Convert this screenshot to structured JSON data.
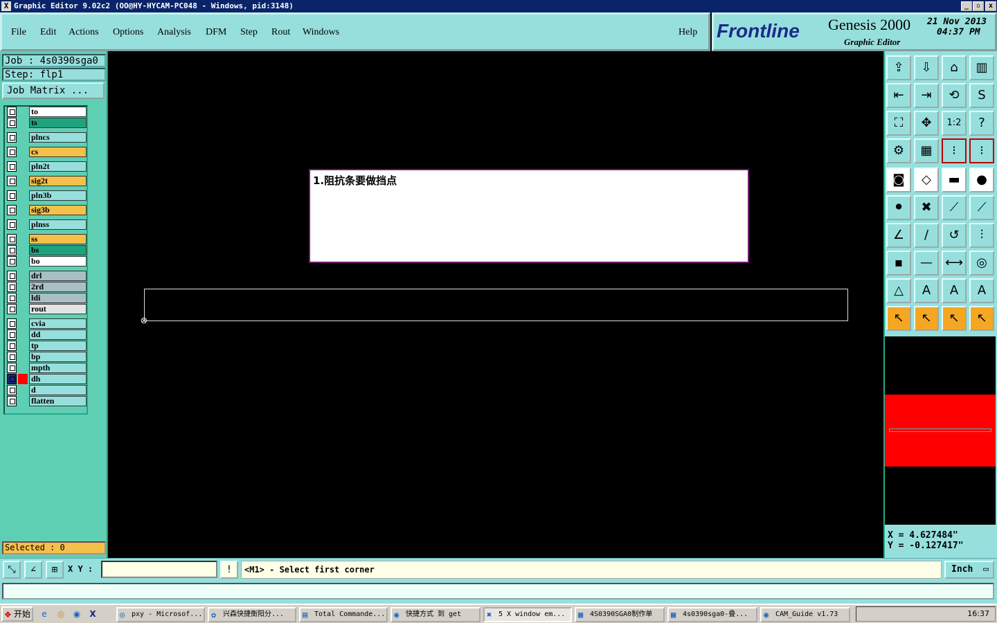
{
  "window": {
    "title": "Graphic Editor 9.02c2 (OO@HY-HYCAM-PC048 - Windows, pid:3148)",
    "controls": [
      "_",
      "▫",
      "x"
    ]
  },
  "menu": {
    "items": [
      "File",
      "Edit",
      "Actions",
      "Options",
      "Analysis",
      "DFM",
      "Step",
      "Rout",
      "Windows"
    ],
    "help": "Help"
  },
  "branding": {
    "logo": "Frontline",
    "product": "Genesis 2000",
    "subtitle": "Graphic Editor",
    "date": "21 Nov 2013",
    "time": "04:37 PM"
  },
  "job": {
    "job_label": "Job : 4s0390sga0",
    "step_label": "Step: flp1",
    "matrix_button": "Job Matrix ..."
  },
  "layers": [
    {
      "name": "to",
      "color": "#ffffff"
    },
    {
      "name": "ts",
      "color": "#1fa37e"
    },
    {
      "name": "plncs",
      "color": "#97dfdc"
    },
    {
      "name": "cs",
      "color": "#f5c04a"
    },
    {
      "name": "pln2t",
      "color": "#97dfdc"
    },
    {
      "name": "sig2t",
      "color": "#f5c04a"
    },
    {
      "name": "pln3b",
      "color": "#97dfdc"
    },
    {
      "name": "sig3b",
      "color": "#f5c04a"
    },
    {
      "name": "plnss",
      "color": "#97dfdc"
    },
    {
      "name": "ss",
      "color": "#f5c04a"
    },
    {
      "name": "bs",
      "color": "#1fa37e"
    },
    {
      "name": "bo",
      "color": "#ffffff"
    },
    {
      "name": "drl",
      "color": "#a8bfc4"
    },
    {
      "name": "2rd",
      "color": "#a8bfc4"
    },
    {
      "name": "ldi",
      "color": "#a8bfc4"
    },
    {
      "name": "rout",
      "color": "#e4e4e4"
    },
    {
      "name": "cvia",
      "color": "#97dfdc"
    },
    {
      "name": "dd",
      "color": "#97dfdc"
    },
    {
      "name": "tp",
      "color": "#97dfdc"
    },
    {
      "name": "bp",
      "color": "#97dfdc"
    },
    {
      "name": "mpth",
      "color": "#97dfdc"
    },
    {
      "name": "dh",
      "color": "#97dfdc",
      "active": true
    },
    {
      "name": "d",
      "color": "#97dfdc"
    },
    {
      "name": "flatten",
      "color": "#97dfdc"
    }
  ],
  "selected": "Selected : 0",
  "canvas": {
    "note_text": "1.阻抗条要做挡点"
  },
  "coords": {
    "x": "X  =  4.627484\"",
    "y": "Y  = -0.127417\""
  },
  "bottom": {
    "xy_label": "X Y :",
    "xy_value": "",
    "prompt": "<M1> - Select first corner",
    "unit": "Inch"
  },
  "taskbar": {
    "start": "开始",
    "items": [
      "pxy - Microsof...",
      "兴森快捷衡阳分...",
      "Total Commande...",
      "快捷方式 到 get",
      "5 X window em...",
      "4S0390SGA0制作单",
      "4s0390sga0-叠...",
      "CAM_Guide v1.73"
    ],
    "clock": "16:37"
  },
  "colors": {
    "panel": "#97dfdc",
    "left_panel": "#5fcfb4",
    "canvas": "#000000",
    "highlight_red": "#ff0000"
  }
}
